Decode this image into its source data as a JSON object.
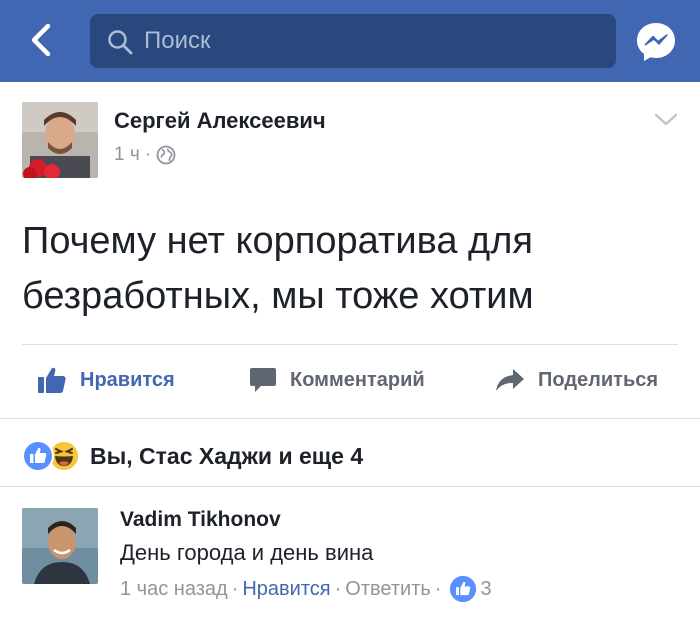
{
  "header": {
    "search_placeholder": "Поиск",
    "back_icon": "chevron-left-icon",
    "messenger_icon": "messenger-icon",
    "bar_color": "#4267b2"
  },
  "post": {
    "author": "Сергей Алексеевич",
    "time": "1 ч",
    "meta_separator": "·",
    "privacy_icon": "globe-icon",
    "text": "Почему нет корпоратива для безработных, мы тоже хотим"
  },
  "actions": {
    "like_label": "Нравится",
    "comment_label": "Комментарий",
    "share_label": "Поделиться"
  },
  "reactions": {
    "summary": "Вы, Стас Хаджи и еще 4",
    "icons": [
      "like-reaction-icon",
      "haha-reaction-icon"
    ]
  },
  "comment": {
    "author": "Vadim Tikhonov",
    "text": "День города и день вина",
    "time": "1 час назад",
    "like_label": "Нравится",
    "reply_label": "Ответить",
    "separator": "·",
    "like_count": "3"
  }
}
